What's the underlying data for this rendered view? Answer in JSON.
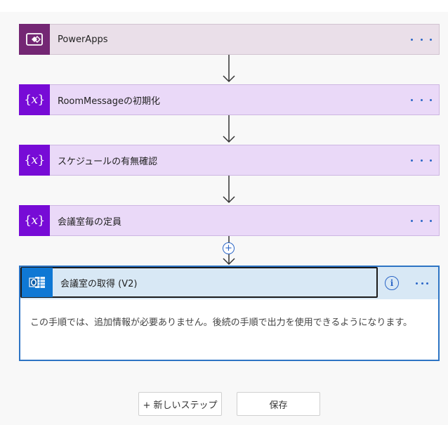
{
  "steps": [
    {
      "label": "PowerApps",
      "icon": "powerapps-icon"
    },
    {
      "label": "RoomMessageの初期化",
      "icon": "variable-icon"
    },
    {
      "label": "スケジュールの有無確認",
      "icon": "variable-icon"
    },
    {
      "label": "会議室毎の定員",
      "icon": "variable-icon"
    }
  ],
  "variable_glyph": "{𝑥}",
  "active_step": {
    "title": "会議室の取得 (V2)",
    "icon": "outlook-icon",
    "info_glyph": "i",
    "body": "この手順では、追加情報が必要ありません。後続の手順で出力を使用できるようになります。"
  },
  "insert_glyph": "+",
  "buttons": {
    "new_step": "+ 新しいステップ",
    "save": "保存"
  },
  "colors": {
    "powerapps": "#742774",
    "variable": "#770bd6",
    "outlook": "#0f78d4",
    "accent": "#2b66c7"
  }
}
